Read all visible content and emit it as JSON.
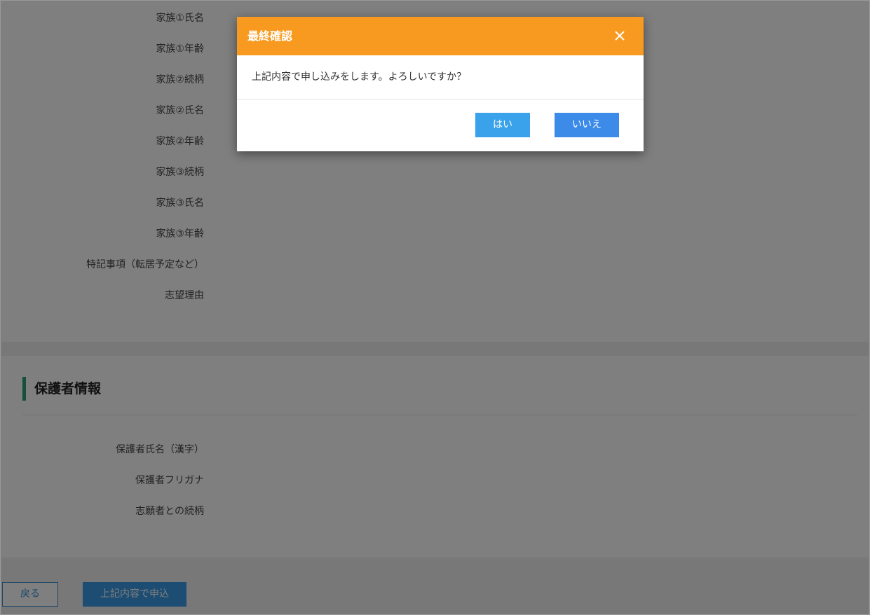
{
  "form": {
    "application_rows": [
      "家族①氏名",
      "家族①年齢",
      "家族②続柄",
      "家族②氏名",
      "家族②年齢",
      "家族③続柄",
      "家族③氏名",
      "家族③年齢",
      "特記事項（転居予定など）",
      "志望理由"
    ],
    "guardian_section": {
      "title": "保護者情報",
      "rows": [
        "保護者氏名（漢字）",
        "保護者フリガナ",
        "志願者との続柄"
      ]
    }
  },
  "footer": {
    "back_label": "戻る",
    "submit_label": "上記内容で申込"
  },
  "modal": {
    "title": "最終確認",
    "message": "上記内容で申し込みをします。よろしいですか？",
    "yes_label": "はい",
    "no_label": "いいえ",
    "close_icon": "close-icon"
  },
  "colors": {
    "modal_header": "#f89a20",
    "primary_button": "#3a9be6",
    "section_accent": "#2e9e7a",
    "overlay": "rgba(0,0,0,0.5)"
  }
}
